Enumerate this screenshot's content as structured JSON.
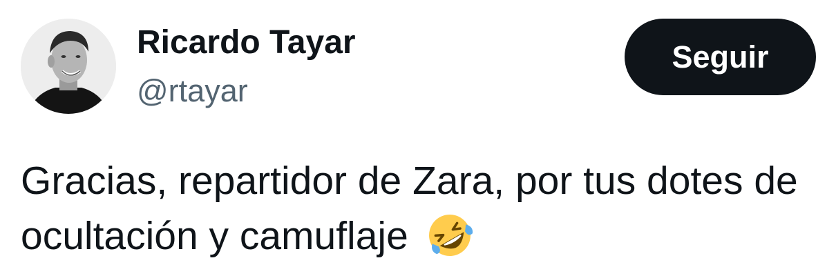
{
  "author": {
    "display_name": "Ricardo Tayar",
    "handle": "@rtayar",
    "avatar_icon": "profile-photo"
  },
  "follow_button": {
    "label": "Seguir",
    "background": "#0f1419",
    "text_color": "#ffffff"
  },
  "tweet": {
    "line1": "Gracias, repartidor de Zara, por tus dotes de",
    "line2": "ocultación y camuflaje",
    "emoji": "rolling-on-the-floor-laughing-emoji"
  },
  "colors": {
    "text_primary": "#0f1419",
    "text_secondary": "#536471"
  }
}
